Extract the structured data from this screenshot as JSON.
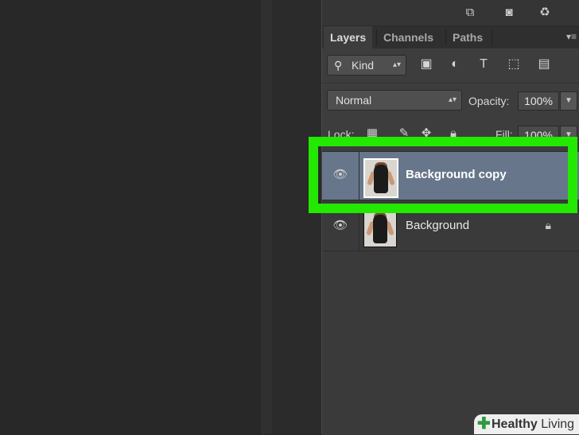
{
  "toolbar": {
    "icons": [
      "new-layer-icon",
      "camera-icon",
      "trash-icon"
    ]
  },
  "tabs": [
    {
      "label": "Layers",
      "active": true
    },
    {
      "label": "Channels",
      "active": false
    },
    {
      "label": "Paths",
      "active": false
    }
  ],
  "filter": {
    "kind_label": "Kind",
    "icons": [
      "image-filter-icon",
      "adjustment-filter-icon",
      "type-filter-icon",
      "shape-filter-icon",
      "smart-object-filter-icon"
    ]
  },
  "blend": {
    "mode": "Normal",
    "opacity_label": "Opacity:",
    "opacity_value": "100%"
  },
  "lock": {
    "label": "Lock:",
    "fill_label": "Fill:",
    "fill_value": "100%"
  },
  "layers": [
    {
      "name": "Background copy",
      "selected": true,
      "locked": false
    },
    {
      "name": "Background",
      "selected": false,
      "locked": true
    }
  ],
  "watermark": {
    "bold": "Healthy",
    "rest": " Living"
  },
  "colors": {
    "highlight": "#22e802",
    "selected_row": "#67768a"
  }
}
